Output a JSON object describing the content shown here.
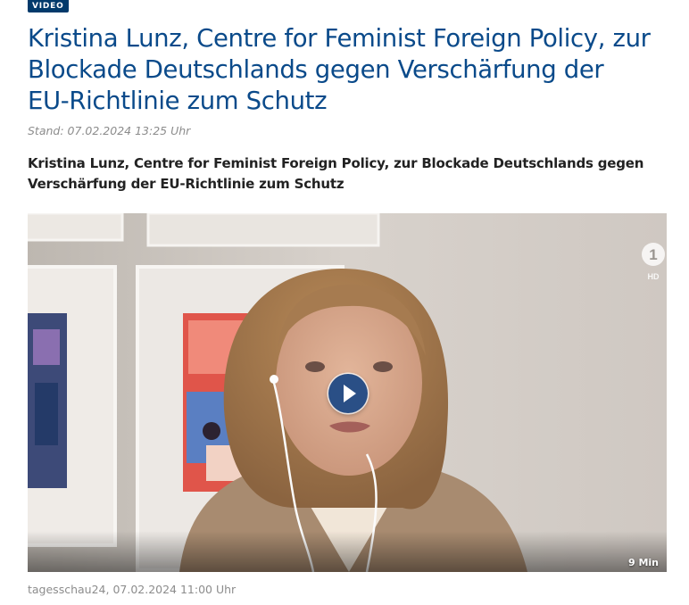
{
  "badge": "VIDEO",
  "headline": "Kristina Lunz, Centre for Feminist Foreign Policy, zur Blockade Deutschlands gegen Verschärfung der EU-Richtlinie zum Schutz",
  "dateline": "Stand: 07.02.2024 13:25 Uhr",
  "teaser": "Kristina Lunz, Centre for Feminist Foreign Policy, zur Blockade Deutschlands gegen Verschärfung der EU-Richtlinie zum Schutz",
  "video": {
    "channel_logo": "ARD 1",
    "quality": "HD",
    "duration": "9 Min",
    "play_icon": "play-icon",
    "colors": {
      "play_button": "#2a4f86",
      "badge": "#013a6b",
      "headline": "#0a4a8a"
    }
  },
  "source": "tagesschau24, 07.02.2024 11:00 Uhr"
}
